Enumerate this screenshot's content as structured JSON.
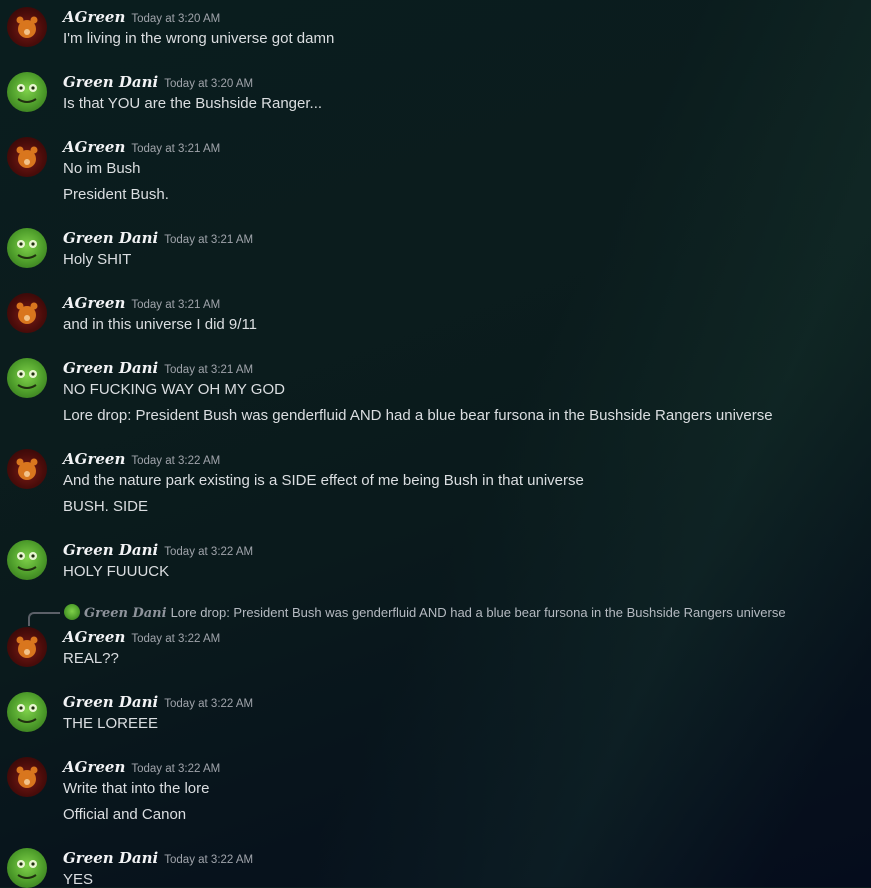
{
  "users": {
    "agreen": {
      "name": "AGreen"
    },
    "dani": {
      "name": "Green Dani"
    }
  },
  "messages": [
    {
      "author": "AGreen",
      "time": "Today at 3:20 AM",
      "lines": [
        "I'm living in the wrong universe got damn"
      ]
    },
    {
      "author": "Green Dani",
      "time": "Today at 3:20 AM",
      "lines": [
        "Is that YOU are the Bushside Ranger..."
      ]
    },
    {
      "author": "AGreen",
      "time": "Today at 3:21 AM",
      "lines": [
        "No im Bush",
        "President Bush."
      ]
    },
    {
      "author": "Green Dani",
      "time": "Today at 3:21 AM",
      "lines": [
        "Holy SHIT"
      ]
    },
    {
      "author": "AGreen",
      "time": "Today at 3:21 AM",
      "lines": [
        "and in this universe I did 9/11"
      ]
    },
    {
      "author": "Green Dani",
      "time": "Today at 3:21 AM",
      "lines": [
        "NO FUCKING WAY OH MY GOD",
        "Lore drop: President Bush was genderfluid AND had a blue bear fursona in the Bushside Rangers universe"
      ]
    },
    {
      "author": "AGreen",
      "time": "Today at 3:22 AM",
      "lines": [
        "And the nature park existing is a SIDE effect of me being Bush in that universe",
        "BUSH. SIDE"
      ]
    },
    {
      "author": "Green Dani",
      "time": "Today at 3:22 AM",
      "lines": [
        "HOLY FUUUCK"
      ]
    },
    {
      "author": "AGreen",
      "time": "Today at 3:22 AM",
      "lines": [
        "REAL??"
      ]
    },
    {
      "author": "Green Dani",
      "time": "Today at 3:22 AM",
      "lines": [
        "THE LOREEE"
      ]
    },
    {
      "author": "AGreen",
      "time": "Today at 3:22 AM",
      "lines": [
        "Write that into the lore",
        "Official and Canon"
      ]
    },
    {
      "author": "Green Dani",
      "time": "Today at 3:22 AM",
      "lines": [
        "YES"
      ]
    }
  ],
  "reply": {
    "author": "Green Dani",
    "text": "Lore drop: President Bush was genderfluid AND had a blue bear fursona in the Bushside Rangers universe"
  }
}
